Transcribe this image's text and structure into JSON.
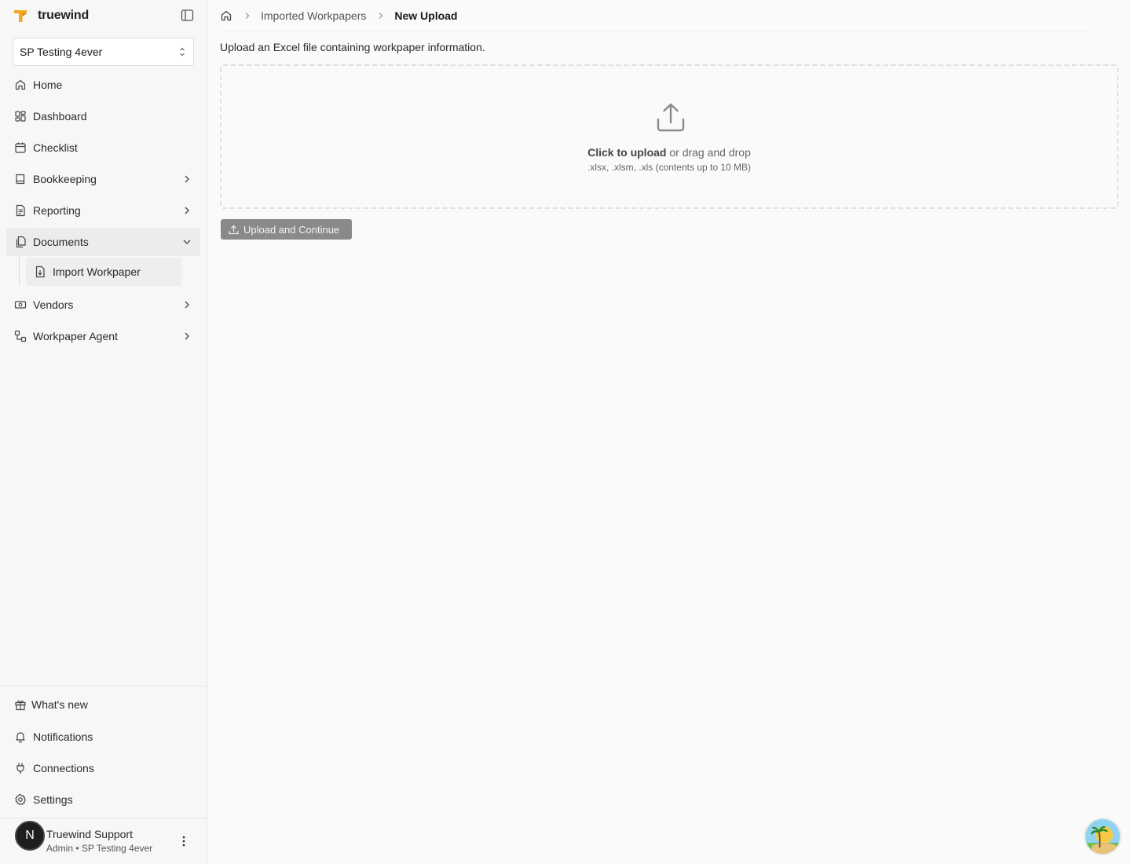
{
  "brand": {
    "name": "truewind",
    "logo_color": "#f5a623"
  },
  "org_selector": {
    "value": "SP Testing 4ever"
  },
  "nav": {
    "items": [
      {
        "label": "Home",
        "icon": "home-icon"
      },
      {
        "label": "Dashboard",
        "icon": "dashboard-icon"
      },
      {
        "label": "Checklist",
        "icon": "calendar-icon"
      },
      {
        "label": "Bookkeeping",
        "icon": "book-icon",
        "expandable": true
      },
      {
        "label": "Reporting",
        "icon": "file-text-icon",
        "expandable": true
      },
      {
        "label": "Documents",
        "icon": "documents-icon",
        "expanded": true,
        "active": true
      },
      {
        "label": "Vendors",
        "icon": "banknote-icon",
        "expandable": true
      },
      {
        "label": "Workpaper Agent",
        "icon": "workflow-icon",
        "expandable": true
      }
    ],
    "documents_sub": [
      {
        "label": "Import Workpaper",
        "icon": "file-import-icon"
      }
    ]
  },
  "bottom_nav": {
    "whats_new": "What's new",
    "notifications": "Notifications",
    "connections": "Connections",
    "settings": "Settings"
  },
  "user": {
    "initial": "N",
    "name": "Truewind Support",
    "role": "Admin • SP Testing 4ever"
  },
  "breadcrumb": {
    "parent": "Imported Workpapers",
    "current": "New Upload"
  },
  "page": {
    "intro": "Upload an Excel file containing workpaper information.",
    "dropzone": {
      "click_text": "Click to upload",
      "rest_text": " or drag and drop",
      "formats": ".xlsx, .xlsm, .xls (contents up to 10 MB)"
    },
    "upload_button": "Upload and Continue"
  }
}
